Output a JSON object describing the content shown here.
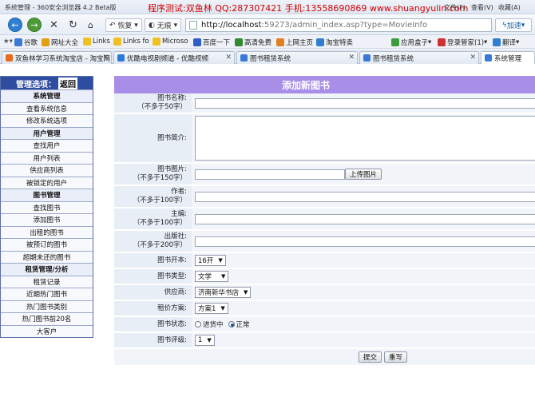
{
  "window": {
    "title": "系统管理 - 360安全浏览器 4.2 Beta版",
    "promo": "程序测试:双鱼林 QQ:287307421 手机:13558690869 www.shuangyulin.com",
    "menu": [
      "文件(F)",
      "查看(V)",
      "收藏(A)"
    ]
  },
  "nav": {
    "reload_label": "恢复",
    "mode_label": "无痕",
    "url_host": "http://localhost",
    "url_path": ":59273/admin_index.asp?type=MovieInfo",
    "speed_label": "加速"
  },
  "bookmarks": [
    {
      "label": "谷歌",
      "color": "#3a79d8"
    },
    {
      "label": "网址大全",
      "color": "#e0a010"
    },
    {
      "label": "Links",
      "color": "#f0c020"
    },
    {
      "label": "Links fo",
      "color": "#f0c020"
    },
    {
      "label": "Microso",
      "color": "#f0c020"
    },
    {
      "label": "百度一下",
      "color": "#2e5ec8"
    },
    {
      "label": "高清免费",
      "color": "#2f8a2f"
    },
    {
      "label": "上网主页",
      "color": "#e08020"
    },
    {
      "label": "淘宝特卖",
      "color": "#2e7fd3"
    },
    {
      "label": "应用盒子",
      "color": "#3c9c3c"
    },
    {
      "label": "登录管家(1)",
      "color": "#d03030"
    },
    {
      "label": "翻译",
      "color": "#2e7fd3"
    }
  ],
  "tabs": [
    {
      "label": "双鱼林学习系统淘宝店 - 淘宝网",
      "color": "#e86a1a"
    },
    {
      "label": "优酷电视剧频道 - 优酷视频",
      "color": "#2b7bd6"
    },
    {
      "label": "图书租赁系统",
      "color": "#3a79d8"
    },
    {
      "label": "图书租赁系统",
      "color": "#3a79d8"
    },
    {
      "label": "系统管理",
      "color": "#3a79d8"
    }
  ],
  "sidebar": {
    "header": "管理选项：",
    "return_label": "返回",
    "items": [
      {
        "label": "系统管理",
        "group": true
      },
      {
        "label": "查看系统信息",
        "group": false
      },
      {
        "label": "修改系统选项",
        "group": false
      },
      {
        "label": "用户管理",
        "group": true
      },
      {
        "label": "查找用户",
        "group": false
      },
      {
        "label": "用户列表",
        "group": false
      },
      {
        "label": "供应商列表",
        "group": false
      },
      {
        "label": "被锁定的用户",
        "group": false
      },
      {
        "label": "图书管理",
        "group": true
      },
      {
        "label": "查找图书",
        "group": false
      },
      {
        "label": "添加图书",
        "group": false
      },
      {
        "label": "出租的图书",
        "group": false
      },
      {
        "label": "被预订的图书",
        "group": false
      },
      {
        "label": "超期未还的图书",
        "group": false
      },
      {
        "label": "租赁管理/分析",
        "group": true
      },
      {
        "label": "租赁记录",
        "group": false
      },
      {
        "label": "近期热门图书",
        "group": false
      },
      {
        "label": "热门图书类别",
        "group": false
      },
      {
        "label": "热门图书前20名",
        "group": false
      },
      {
        "label": "大客户",
        "group": false
      }
    ]
  },
  "form": {
    "title": "添加新图书",
    "name_label": "图书名称:",
    "name_note": "（不多于50字）",
    "intro_label": "图书简介:",
    "image_label": "图书图片:",
    "image_note": "（不多于150字）",
    "upload_label": "上传图片",
    "author_label": "作者:",
    "author_note": "（不多于100字）",
    "editor_label": "主编:",
    "editor_note": "（不多于100字）",
    "publisher_label": "出版社:",
    "publisher_note": "（不多于200字）",
    "format_label": "图书开本:",
    "format_value": "16开",
    "type_label": "图书类型:",
    "type_value": "文学",
    "supplier_label": "供应商:",
    "supplier_value": "济南新华书店",
    "rent_label": "租价方案:",
    "rent_value": "方案1",
    "status_label": "图书状态:",
    "status_opt1": "进货中",
    "status_opt2": "正常",
    "rating_label": "图书评级:",
    "rating_value": "1",
    "submit_label": "提交",
    "reset_label": "重写"
  }
}
